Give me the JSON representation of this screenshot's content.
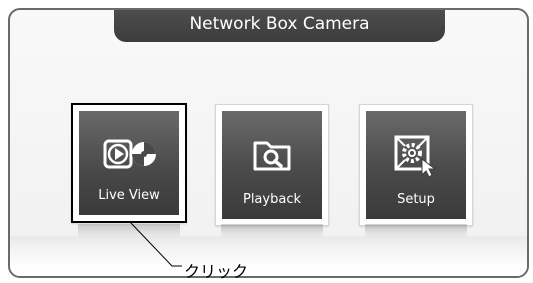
{
  "window": {
    "title": "Network Box Camera"
  },
  "buttons": [
    {
      "label": "Live View",
      "icon": "live-view-icon"
    },
    {
      "label": "Playback",
      "icon": "playback-folder-search-icon"
    },
    {
      "label": "Setup",
      "icon": "setup-gear-cursor-icon"
    }
  ],
  "annotation": {
    "text": "クリック"
  }
}
